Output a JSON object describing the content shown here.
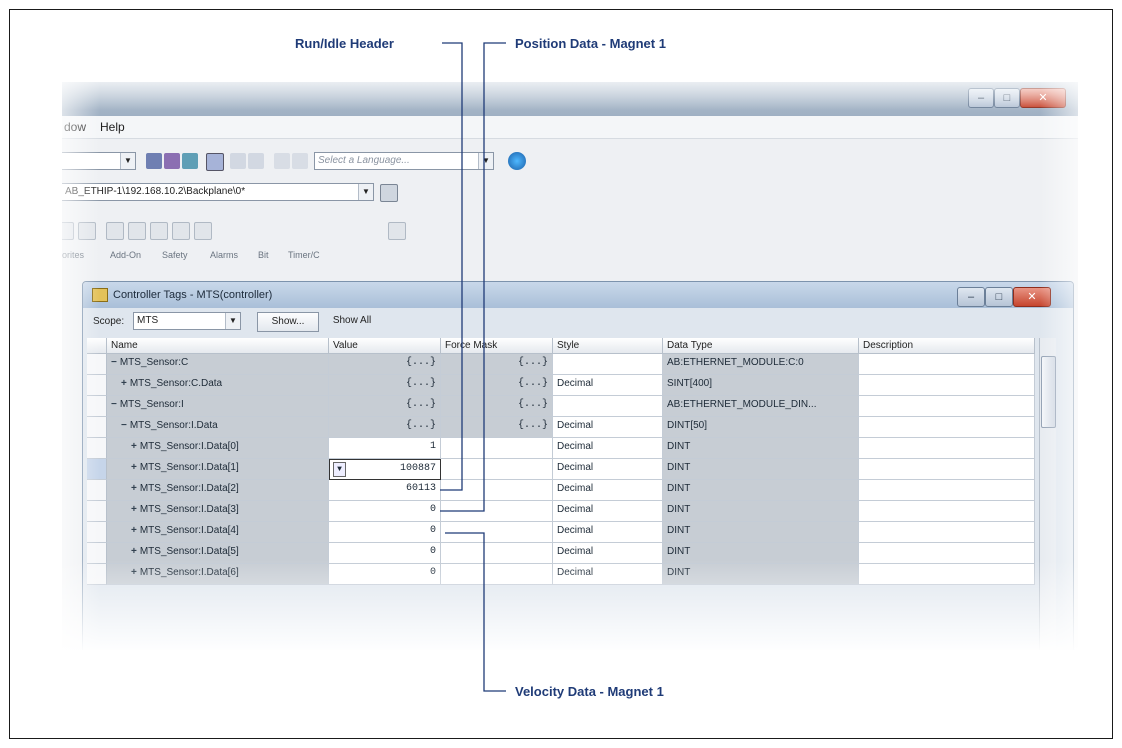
{
  "callouts": {
    "run_idle": "Run/Idle Header",
    "position": "Position Data - Magnet 1",
    "velocity": "Velocity Data - Magnet 1"
  },
  "app": {
    "title_blurred": "                ",
    "menu": [
      "dow",
      "Help"
    ],
    "language_placeholder": "Select a Language...",
    "path": "AB_ETHIP-1\\192.168.10.2\\Backplane\\0*",
    "instruction_tabs": [
      "orites",
      "Add-On",
      "Safety",
      "Alarms",
      "Bit",
      "Timer/C"
    ]
  },
  "controller_tags": {
    "title": "Controller Tags - MTS(controller)",
    "scope_label": "Scope:",
    "scope_value": "MTS",
    "show_button": "Show...",
    "show_all": "Show All",
    "columns": [
      "Name",
      "Value",
      "Force Mask",
      "Style",
      "Data Type",
      "Description"
    ],
    "rows": [
      {
        "expander": "−",
        "indent": 0,
        "name": "MTS_Sensor:C",
        "value": "{...}",
        "force": "{...}",
        "style": "",
        "type": "AB:ETHERNET_MODULE:C:0"
      },
      {
        "expander": "+",
        "indent": 1,
        "name": "MTS_Sensor:C.Data",
        "value": "{...}",
        "force": "{...}",
        "style": "Decimal",
        "type": "SINT[400]"
      },
      {
        "expander": "−",
        "indent": 0,
        "name": "MTS_Sensor:I",
        "value": "{...}",
        "force": "{...}",
        "style": "",
        "type": "AB:ETHERNET_MODULE_DIN..."
      },
      {
        "expander": "−",
        "indent": 1,
        "name": "MTS_Sensor:I.Data",
        "value": "{...}",
        "force": "{...}",
        "style": "Decimal",
        "type": "DINT[50]"
      },
      {
        "expander": "+",
        "indent": 2,
        "name": "MTS_Sensor:I.Data[0]",
        "value": "1",
        "force": "",
        "style": "Decimal",
        "type": "DINT"
      },
      {
        "expander": "+",
        "indent": 2,
        "name": "MTS_Sensor:I.Data[1]",
        "value": "100887",
        "force": "",
        "style": "Decimal",
        "type": "DINT"
      },
      {
        "expander": "+",
        "indent": 2,
        "name": "MTS_Sensor:I.Data[2]",
        "value": "60113",
        "force": "",
        "style": "Decimal",
        "type": "DINT"
      },
      {
        "expander": "+",
        "indent": 2,
        "name": "MTS_Sensor:I.Data[3]",
        "value": "0",
        "force": "",
        "style": "Decimal",
        "type": "DINT"
      },
      {
        "expander": "+",
        "indent": 2,
        "name": "MTS_Sensor:I.Data[4]",
        "value": "0",
        "force": "",
        "style": "Decimal",
        "type": "DINT"
      },
      {
        "expander": "+",
        "indent": 2,
        "name": "MTS_Sensor:I.Data[5]",
        "value": "0",
        "force": "",
        "style": "Decimal",
        "type": "DINT"
      },
      {
        "expander": "+",
        "indent": 2,
        "name": "MTS_Sensor:I.Data[6]",
        "value": "0",
        "force": "",
        "style": "Decimal",
        "type": "DINT"
      }
    ]
  },
  "colors": {
    "callout": "#1f3b77",
    "row_gray": "#c7cdd4",
    "row_white": "#ffffff"
  }
}
